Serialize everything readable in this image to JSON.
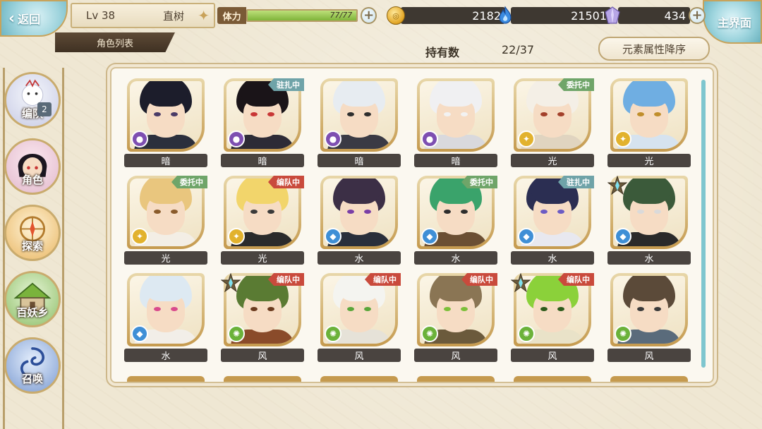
{
  "top": {
    "back_label": "返回",
    "level": "Lv 38",
    "player_name": "直树",
    "stamina_label": "体力",
    "stamina_value": "77/77",
    "stamina_fraction": 1.0,
    "coins": "2182",
    "spirit": "21501",
    "crystals": "434",
    "home_label": "主界面",
    "tab_label": "角色列表"
  },
  "owned": {
    "label": "持有数",
    "count": "22/37"
  },
  "sort": {
    "label": "元素属性降序"
  },
  "sidebar": {
    "items": [
      {
        "label": "编队",
        "badge": "2",
        "icon": "team-icon"
      },
      {
        "label": "角色",
        "icon": "character-icon"
      },
      {
        "label": "探索",
        "icon": "explore-icon"
      },
      {
        "label": "百妖乡",
        "icon": "village-icon"
      },
      {
        "label": "召唤",
        "icon": "summon-icon"
      }
    ]
  },
  "elements": {
    "暗": "#7e4fb1",
    "光": "#e2b22d",
    "水": "#3f8fd6",
    "风": "#6bb23a"
  },
  "characters": [
    {
      "element": "暗",
      "status": "",
      "hair": "#1c1d2b",
      "outfit": "#2b2f3c",
      "eyes": "#4a3b67",
      "star": false
    },
    {
      "element": "暗",
      "status": "驻扎中",
      "status_type": "station",
      "hair": "#1a1418",
      "outfit": "#2d2b36",
      "eyes": "#c83636",
      "star": false
    },
    {
      "element": "暗",
      "status": "",
      "hair": "#e7ecf1",
      "outfit": "#3a3a44",
      "eyes": "#2e2e2e",
      "star": false
    },
    {
      "element": "暗",
      "status": "",
      "hair": "#f0f0f2",
      "outfit": "#d9d9dd",
      "eyes": "#f2f2f2",
      "star": false
    },
    {
      "element": "光",
      "status": "委托中",
      "status_type": "dispatch",
      "hair": "#f4efe6",
      "outfit": "#e0d4c0",
      "eyes": "#a3402b",
      "star": false
    },
    {
      "element": "光",
      "status": "",
      "hair": "#6faee2",
      "outfit": "#d6e3ef",
      "eyes": "#c08e2b",
      "star": false
    },
    {
      "element": "光",
      "status": "委托中",
      "status_type": "dispatch",
      "hair": "#e9c67e",
      "outfit": "#f3eee5",
      "eyes": "#8a5b2b",
      "star": false
    },
    {
      "element": "光",
      "status": "编队中",
      "status_type": "team",
      "hair": "#f2d56b",
      "outfit": "#2b2b2b",
      "eyes": "#3a3a3a",
      "star": false
    },
    {
      "element": "水",
      "status": "",
      "hair": "#3c2f46",
      "outfit": "#2a2f3b",
      "eyes": "#7a3ea6",
      "star": false
    },
    {
      "element": "水",
      "status": "委托中",
      "status_type": "dispatch",
      "hair": "#3aa36b",
      "outfit": "#6b4f33",
      "eyes": "#2d2d2d",
      "star": false
    },
    {
      "element": "水",
      "status": "驻扎中",
      "status_type": "station",
      "hair": "#2b2e52",
      "outfit": "#e8e8ef",
      "eyes": "#6b5bc4",
      "star": false
    },
    {
      "element": "水",
      "status": "",
      "hair": "#3b5a3a",
      "outfit": "#2a2a2a",
      "eyes": "#dadada",
      "star": true
    },
    {
      "element": "水",
      "status": "",
      "hair": "#dde9f2",
      "outfit": "#f2eee8",
      "eyes": "#d94b8c",
      "star": false
    },
    {
      "element": "风",
      "status": "编队中",
      "status_type": "team",
      "hair": "#5a7b33",
      "outfit": "#8a4b2a",
      "eyes": "#6b3b1f",
      "star": true
    },
    {
      "element": "风",
      "status": "编队中",
      "status_type": "team",
      "hair": "#f4f4f0",
      "outfit": "#e6e2d8",
      "eyes": "#5aa63b",
      "star": false
    },
    {
      "element": "风",
      "status": "编队中",
      "status_type": "team",
      "hair": "#8a7554",
      "outfit": "#6b5a3c",
      "eyes": "#7cbf3a",
      "star": false
    },
    {
      "element": "风",
      "status": "编队中",
      "status_type": "team",
      "hair": "#8bd13a",
      "outfit": "#e9e2c8",
      "eyes": "#2d5b1b",
      "star": true
    },
    {
      "element": "风",
      "status": "",
      "hair": "#5b4a39",
      "outfit": "#5a6b7b",
      "eyes": "#3b3b3b",
      "star": false
    }
  ]
}
